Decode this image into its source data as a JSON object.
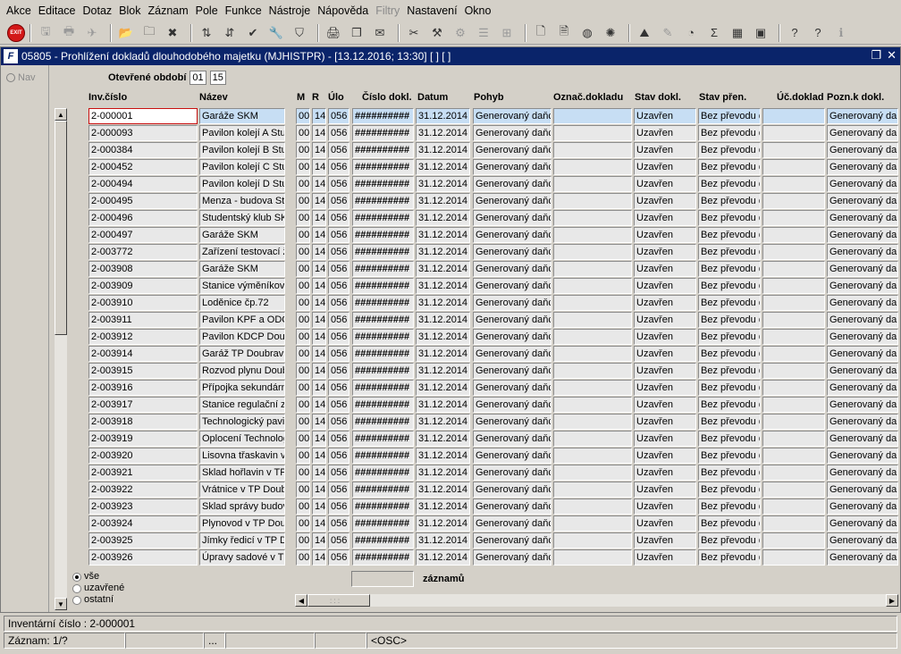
{
  "menu": [
    "Akce",
    "Editace",
    "Dotaz",
    "Blok",
    "Záznam",
    "Pole",
    "Funkce",
    "Nástroje",
    "Nápověda",
    "Filtry",
    "Nastavení",
    "Okno"
  ],
  "menu_disabled": "Filtry",
  "toolbar": {
    "exit_label": "EXIT",
    "icons": [
      "save-icon",
      "print-icon",
      "send-icon",
      "folder-open-icon",
      "folder-new-icon",
      "delete-icon",
      "sort-asc-icon",
      "sort-desc-icon",
      "check-icon",
      "wrench-icon",
      "filter-icon",
      "printer-icon",
      "copy-icon",
      "mail-icon",
      "cut-icon",
      "tools-icon",
      "config-icon",
      "list-icon",
      "tree-icon",
      "new-doc-icon",
      "doc-icon",
      "globe-icon",
      "gear-icon",
      "drive-icon",
      "pen-icon",
      "chart-icon",
      "sigma-icon",
      "excel-icon",
      "calendar-icon",
      "help-icon",
      "help2-icon",
      "info-icon"
    ]
  },
  "window": {
    "logo": "F",
    "title": "05805 - Prohlížení dokladů dlouhodobého majetku (MJHISTPR) - [13.12.2016; 13:30]  [ ] [ ]"
  },
  "nav_label": "Nav",
  "period": {
    "label": "Otevřené období",
    "month": "01",
    "year": "15"
  },
  "columns": [
    "Inv.číslo",
    "Název",
    "M",
    "R",
    "Úlo",
    "Číslo dokl.",
    "Datum",
    "Pohyb",
    "Označ.dokladu",
    "Stav dokl.",
    "Stav přen.",
    "Úč.doklad",
    "Pozn.k dokl."
  ],
  "constants": {
    "m": "00",
    "r": "14",
    "ulo": "056",
    "cislo": "##########",
    "datum": "31.12.2014",
    "pohyb": "Generovaný daňc",
    "stav_dokl": "Uzavřen",
    "stav_pren": "Bez převodu d",
    "pozn": "Generovaný da"
  },
  "rows": [
    {
      "inv": "2-000001",
      "nazev": "Garáže SKM"
    },
    {
      "inv": "2-000093",
      "nazev": "Pavilon kolejí A Stud"
    },
    {
      "inv": "2-000384",
      "nazev": "Pavilon kolejí B Stud"
    },
    {
      "inv": "2-000452",
      "nazev": "Pavilon kolejí C Stud"
    },
    {
      "inv": "2-000494",
      "nazev": "Pavilon kolejí D Stud"
    },
    {
      "inv": "2-000495",
      "nazev": "Menza - budova Stu"
    },
    {
      "inv": "2-000496",
      "nazev": "Studentský klub SKI"
    },
    {
      "inv": "2-000497",
      "nazev": "Garáže SKM"
    },
    {
      "inv": "2-003772",
      "nazev": "Zařízení testovací ž"
    },
    {
      "inv": "2-003908",
      "nazev": "Garáže SKM"
    },
    {
      "inv": "2-003909",
      "nazev": "Stanice výměníková"
    },
    {
      "inv": "2-003910",
      "nazev": "Loděnice čp.72"
    },
    {
      "inv": "2-003911",
      "nazev": "Pavilon KPF a ODCF"
    },
    {
      "inv": "2-003912",
      "nazev": "Pavilon KDCP Doubr"
    },
    {
      "inv": "2-003914",
      "nazev": "Garáž TP Doubravic"
    },
    {
      "inv": "2-003915",
      "nazev": "Rozvod plynu Doub"
    },
    {
      "inv": "2-003916",
      "nazev": "Přípojka sekundární"
    },
    {
      "inv": "2-003917",
      "nazev": "Stanice regulační ze"
    },
    {
      "inv": "2-003918",
      "nazev": "Technologický pavil"
    },
    {
      "inv": "2-003919",
      "nazev": "Oplocení Technolog"
    },
    {
      "inv": "2-003920",
      "nazev": "Lisovna třaskavin v"
    },
    {
      "inv": "2-003921",
      "nazev": "Sklad hořlavin v TP"
    },
    {
      "inv": "2-003922",
      "nazev": "Vrátnice v TP Doub"
    },
    {
      "inv": "2-003923",
      "nazev": "Sklad správy budov"
    },
    {
      "inv": "2-003924",
      "nazev": "Plynovod v TP Doub"
    },
    {
      "inv": "2-003925",
      "nazev": "Jímky ředicí v TP Do"
    },
    {
      "inv": "2-003926",
      "nazev": "Úpravy sadové v TP"
    }
  ],
  "filters": [
    {
      "label": "vše",
      "selected": true
    },
    {
      "label": "uzavřené",
      "selected": false
    },
    {
      "label": "ostatní",
      "selected": false
    }
  ],
  "record_count_label": "záznamů",
  "hscroll_thumb_text": ": : :",
  "status": {
    "line1": "Inventární číslo : 2-000001",
    "record": "Záznam: 1/?",
    "ellipsis": "...",
    "mode": "<OSC>"
  }
}
